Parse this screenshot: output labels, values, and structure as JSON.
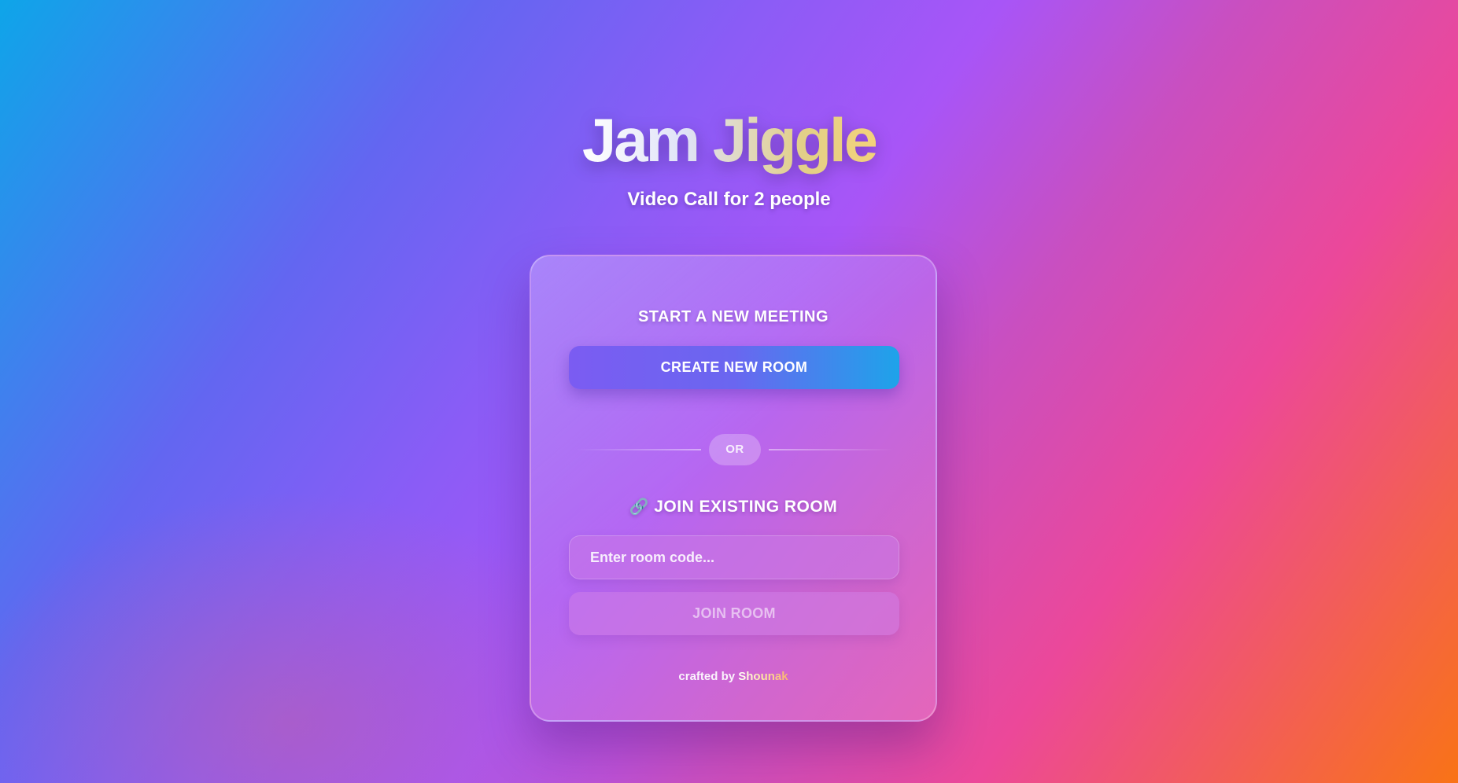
{
  "hero": {
    "title": "Jam Jiggle",
    "subtitle": "Video Call for 2 people"
  },
  "card": {
    "start_section": {
      "title": "START A NEW MEETING",
      "create_button_label": "CREATE NEW ROOM"
    },
    "divider_label": "OR",
    "join_section": {
      "icon": "link-icon",
      "title": "JOIN EXISTING ROOM",
      "input_value": "",
      "input_placeholder": "Enter room code...",
      "join_button_label": "JOIN ROOM",
      "join_button_disabled": true
    },
    "footer": {
      "prefix": "crafted by ",
      "author": "Shounak"
    }
  },
  "colors": {
    "gradient_start": "#0ea5e9",
    "gradient_mid": "#a855f7",
    "gradient_end": "#f97316",
    "create_button_start": "#7b5cf2",
    "create_button_end": "#1ea3ea"
  }
}
